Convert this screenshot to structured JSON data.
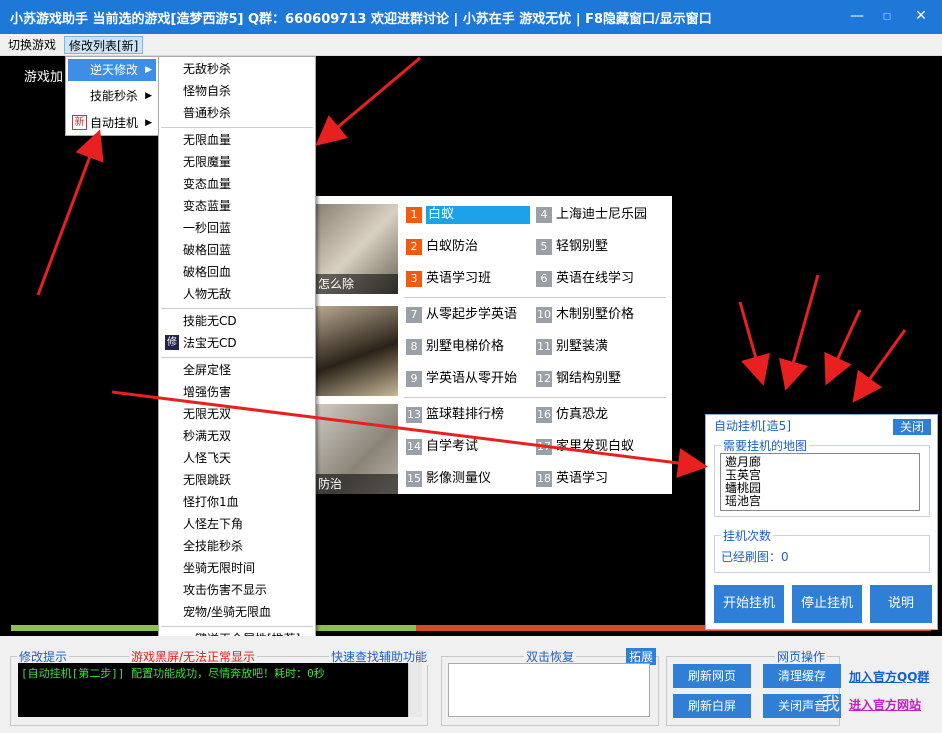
{
  "window": {
    "title": "小苏游戏助手 当前选的游戏[造梦西游5] Q群：660609713 欢迎进群讨论    | 小苏在手 游戏无忧 |    F8隐藏窗口/显示窗口",
    "min_glyph": "—",
    "max_glyph": "▫",
    "close_glyph": "✕"
  },
  "menubar": {
    "switch_game": "切换游戏",
    "modify_list": "修改列表[新]"
  },
  "game": {
    "loading_text": "游戏加"
  },
  "submenu1": {
    "items": [
      {
        "label": "逆天修改",
        "arrow": "▶"
      },
      {
        "label": "技能秒杀",
        "arrow": "▶"
      },
      {
        "label": "自动挂机",
        "arrow": "▶",
        "badge": "新"
      }
    ]
  },
  "submenu2": {
    "items": [
      "无敌秒杀",
      "怪物自杀",
      "普通秒杀",
      "无限血量",
      "无限魔量",
      "变态血量",
      "变态蓝量",
      "一秒回蓝",
      "破格回蓝",
      "破格回血",
      "人物无敌",
      "技能无CD",
      "法宝无CD",
      "全屏定怪",
      "增强伤害",
      "无限无双",
      "秒满无双",
      "人怪飞天",
      "无限跳跃",
      "怪打你1血",
      "人怪左下角",
      "全技能秒杀",
      "坐骑无限时间",
      "攻击伤害不显示",
      "宠物/坐骑无限血",
      "一键逆天全属性[推荐]"
    ],
    "badge_xiu": "修"
  },
  "ad": {
    "captions": [
      "怎么除",
      "",
      "防治"
    ],
    "items": [
      {
        "n": "1",
        "t": "白蚁"
      },
      {
        "n": "4",
        "t": "上海迪士尼乐园"
      },
      {
        "n": "2",
        "t": "白蚁防治"
      },
      {
        "n": "5",
        "t": "轻钢别墅"
      },
      {
        "n": "3",
        "t": "英语学习班"
      },
      {
        "n": "6",
        "t": "英语在线学习"
      },
      {
        "n": "7",
        "t": "从零起步学英语"
      },
      {
        "n": "10",
        "t": "木制别墅价格"
      },
      {
        "n": "8",
        "t": "别墅电梯价格"
      },
      {
        "n": "11",
        "t": "别墅装潢"
      },
      {
        "n": "9",
        "t": "学英语从零开始"
      },
      {
        "n": "12",
        "t": "钢结构别墅"
      },
      {
        "n": "13",
        "t": "篮球鞋排行榜"
      },
      {
        "n": "16",
        "t": "仿真恐龙"
      },
      {
        "n": "14",
        "t": "自学考试"
      },
      {
        "n": "17",
        "t": "家里发现白蚁"
      },
      {
        "n": "15",
        "t": "影像测量仪"
      },
      {
        "n": "18",
        "t": "英语学习"
      }
    ]
  },
  "progress": {
    "value": 0.44
  },
  "autopanel": {
    "title": "自动挂机[造5]",
    "close": "关闭",
    "maps_label": "需要挂机的地图",
    "maps": [
      "邀月廊",
      "玉英宫",
      "蟠桃园",
      "瑶池宫"
    ],
    "count_label": "挂机次数",
    "count_text": "已经刷图：0",
    "start": "开始挂机",
    "stop": "停止挂机",
    "help": "说明"
  },
  "bottom": {
    "hint_label": "修改提示",
    "black_screen": "游戏黑屏/无法正常显示",
    "quick_find": "快速查找辅助功能",
    "log": "[自动挂机[第二步]] 配置功能成功，尽情奔放吧！耗时：0秒",
    "dblclick_label": "双击恢复",
    "expand": "拓展",
    "web_label": "网页操作",
    "refresh_page": "刷新网页",
    "clear_cache": "清理缓存",
    "refresh_white": "刷新白屏",
    "mute": "关闭声音",
    "join_group": "加入官方QQ群",
    "official_site": "进入官方网站",
    "me": "我"
  }
}
